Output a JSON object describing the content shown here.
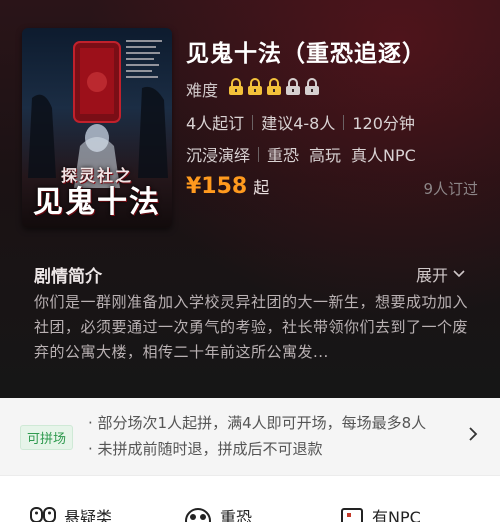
{
  "product": {
    "title": "见鬼十法（重恐追逐）",
    "difficulty_label": "难度",
    "difficulty_level": 3,
    "difficulty_max": 5,
    "meta": [
      "4人起订",
      "建议4-8人",
      "120分钟"
    ],
    "tags": [
      "沉浸演绎",
      "重恐",
      "高玩",
      "真人NPC"
    ],
    "price": "¥158",
    "price_suffix": "起",
    "booked": "9人订过"
  },
  "poster": {
    "subtitle": "探灵社之",
    "main": "见鬼十法"
  },
  "synopsis": {
    "title": "剧情简介",
    "expand": "展开",
    "text": "你们是一群刚准备加入学校灵异社团的大一新生，想要成功加入社团，必须要通过一次勇气的考验，社长带领你们去到了一个废弃的公寓大楼，相传二十年前这所公寓发..."
  },
  "group": {
    "badge": "可拼场",
    "line1": "· 部分场次1人起拼，满4人即可开场，每场最多8人",
    "line2": "· 未拼成前随时退，拼成后不可退款"
  },
  "features": [
    {
      "label": "悬疑类",
      "icon": "mask-icon"
    },
    {
      "label": "重恐",
      "icon": "ghost-face-icon"
    },
    {
      "label": "有NPC",
      "icon": "npc-icon"
    }
  ],
  "colors": {
    "price": "#ff9a1e",
    "lock_active": "#f3c13a",
    "lock_inactive": "#d6d0d0",
    "badge_green": "#2f9a4f"
  }
}
